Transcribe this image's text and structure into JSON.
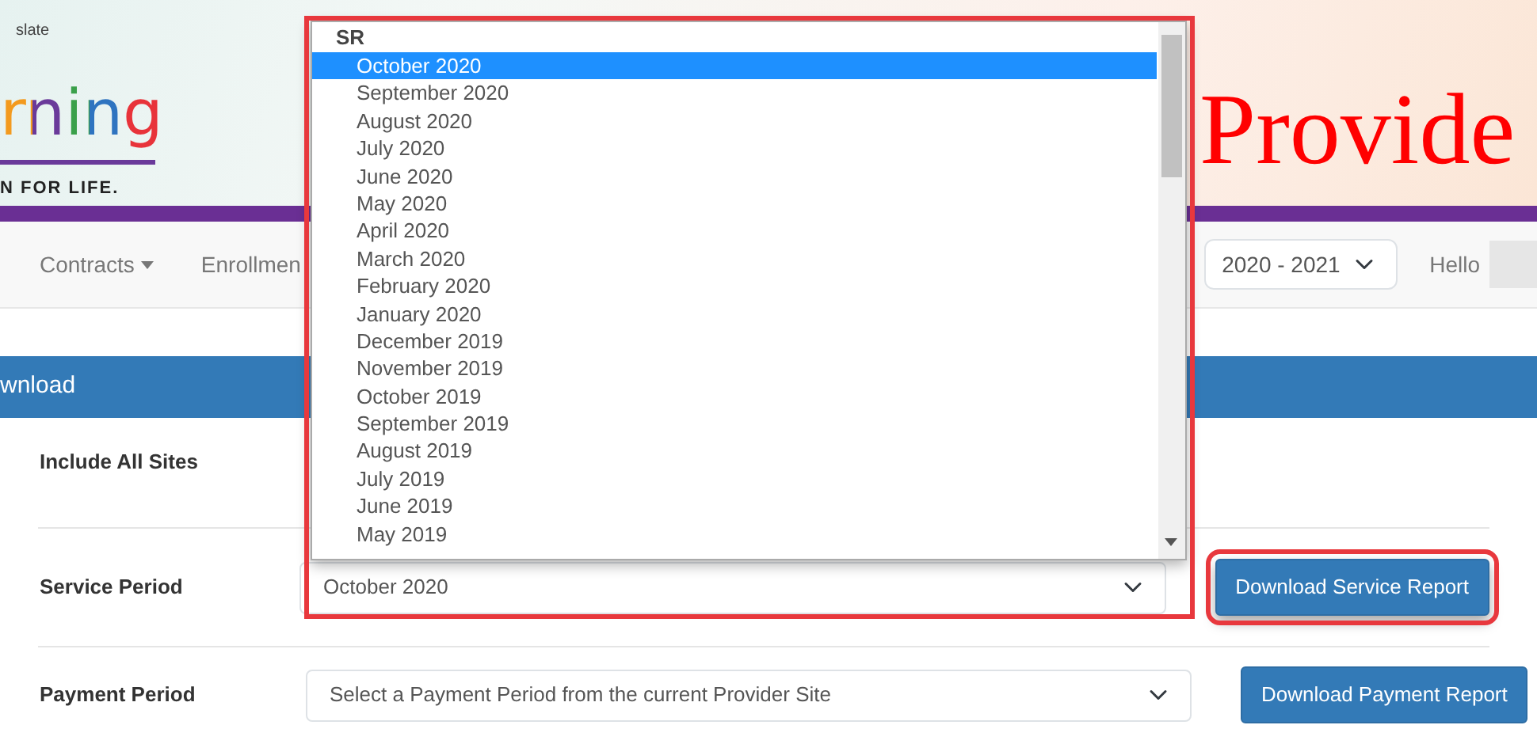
{
  "header": {
    "corner_text": "slate",
    "logo_text": "rning",
    "logo_tagline": "N FOR LIFE.",
    "title": "Provide"
  },
  "nav": {
    "items": [
      {
        "label": "Contracts",
        "dropdown": true
      },
      {
        "label": "Enrollmen",
        "dropdown": false
      }
    ],
    "year_select": {
      "value": "2020 - 2021"
    },
    "greeting": "Hello"
  },
  "panel": {
    "heading": "wnload",
    "rows": [
      {
        "label": "Include All Sites"
      },
      {
        "label": "Service Period",
        "select": {
          "value": "October 2020"
        },
        "button": "Download Service Report",
        "highlighted": true
      },
      {
        "label": "Payment Period",
        "select": {
          "placeholder": "Select a Payment Period from the current Provider Site"
        },
        "button": "Download Payment Report",
        "highlighted": false
      }
    ]
  },
  "dropdown_list": {
    "group": "SR",
    "options": [
      {
        "label": "October 2020",
        "selected": true
      },
      {
        "label": "September 2020",
        "selected": false
      },
      {
        "label": "August 2020",
        "selected": false
      },
      {
        "label": "July 2020",
        "selected": false
      },
      {
        "label": "June 2020",
        "selected": false
      },
      {
        "label": "May 2020",
        "selected": false
      },
      {
        "label": "April 2020",
        "selected": false
      },
      {
        "label": "March 2020",
        "selected": false
      },
      {
        "label": "February 2020",
        "selected": false
      },
      {
        "label": "January 2020",
        "selected": false
      },
      {
        "label": "December 2019",
        "selected": false
      },
      {
        "label": "November 2019",
        "selected": false
      },
      {
        "label": "October 2019",
        "selected": false
      },
      {
        "label": "September 2019",
        "selected": false
      },
      {
        "label": "August 2019",
        "selected": false
      },
      {
        "label": "July 2019",
        "selected": false
      },
      {
        "label": "June 2019",
        "selected": false
      },
      {
        "label": "May 2019",
        "selected": false
      }
    ]
  }
}
